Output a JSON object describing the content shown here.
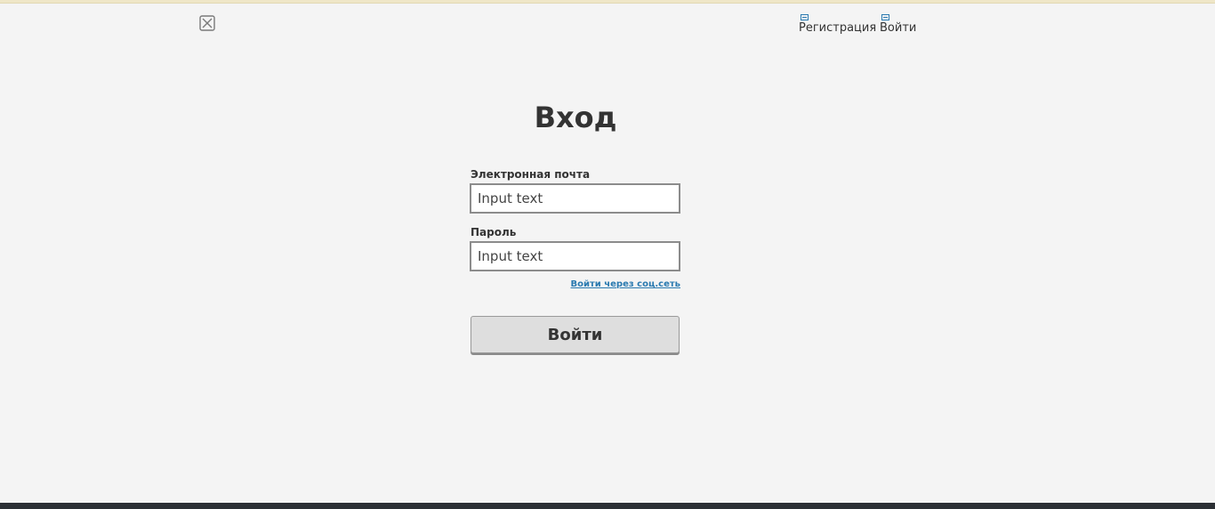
{
  "header": {
    "logo_icon": "broken-image-icon",
    "nav": [
      {
        "label": "Регистрация",
        "icon": "broken-image-icon"
      },
      {
        "label": "Войти",
        "icon": "broken-image-icon"
      }
    ]
  },
  "form": {
    "title": "Вход",
    "email": {
      "label": "Электронная почта",
      "placeholder": "Input text"
    },
    "password": {
      "label": "Пароль",
      "placeholder": "Input text"
    },
    "social_link": "Войти через соц.сеть",
    "submit_label": "Войти"
  },
  "colors": {
    "background": "#f4f4f4",
    "text": "#333333",
    "link": "#2a7ab0",
    "button": "#dedede",
    "bottom_bar": "#2c3035"
  }
}
